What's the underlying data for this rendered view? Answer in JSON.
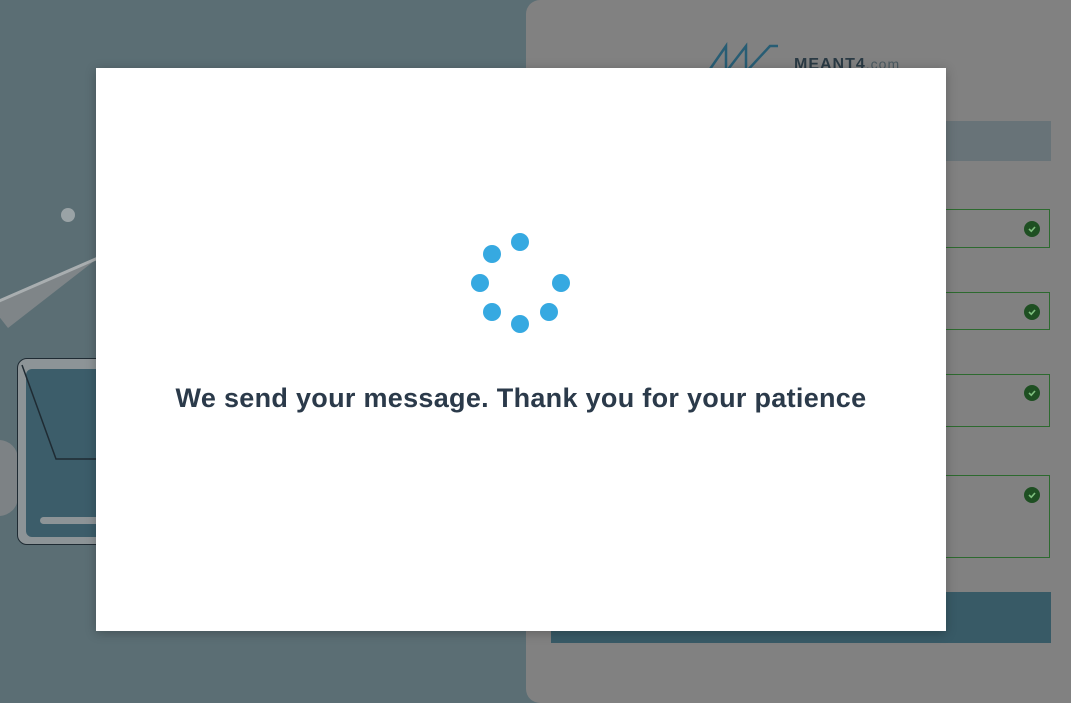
{
  "background": {
    "brand": {
      "name": "MEANT4",
      "tld": ".com",
      "logo_icon": "meant4-zigzag-logo-icon"
    },
    "form": {
      "fields": [
        {
          "status_icon": "check-circle-icon"
        },
        {
          "status_icon": "check-circle-icon"
        },
        {
          "status_icon": "check-circle-icon"
        },
        {
          "status_icon": "check-circle-icon"
        }
      ]
    }
  },
  "modal": {
    "spinner_icon": "loading-dots-spinner-icon",
    "message": "We send your message. Thank you for your patience"
  },
  "colors": {
    "overlay_backdrop": "#5b6e74",
    "spinner": "#36a9e1",
    "message_text": "#2b3a4a",
    "field_valid_border": "#2d6a2f"
  }
}
